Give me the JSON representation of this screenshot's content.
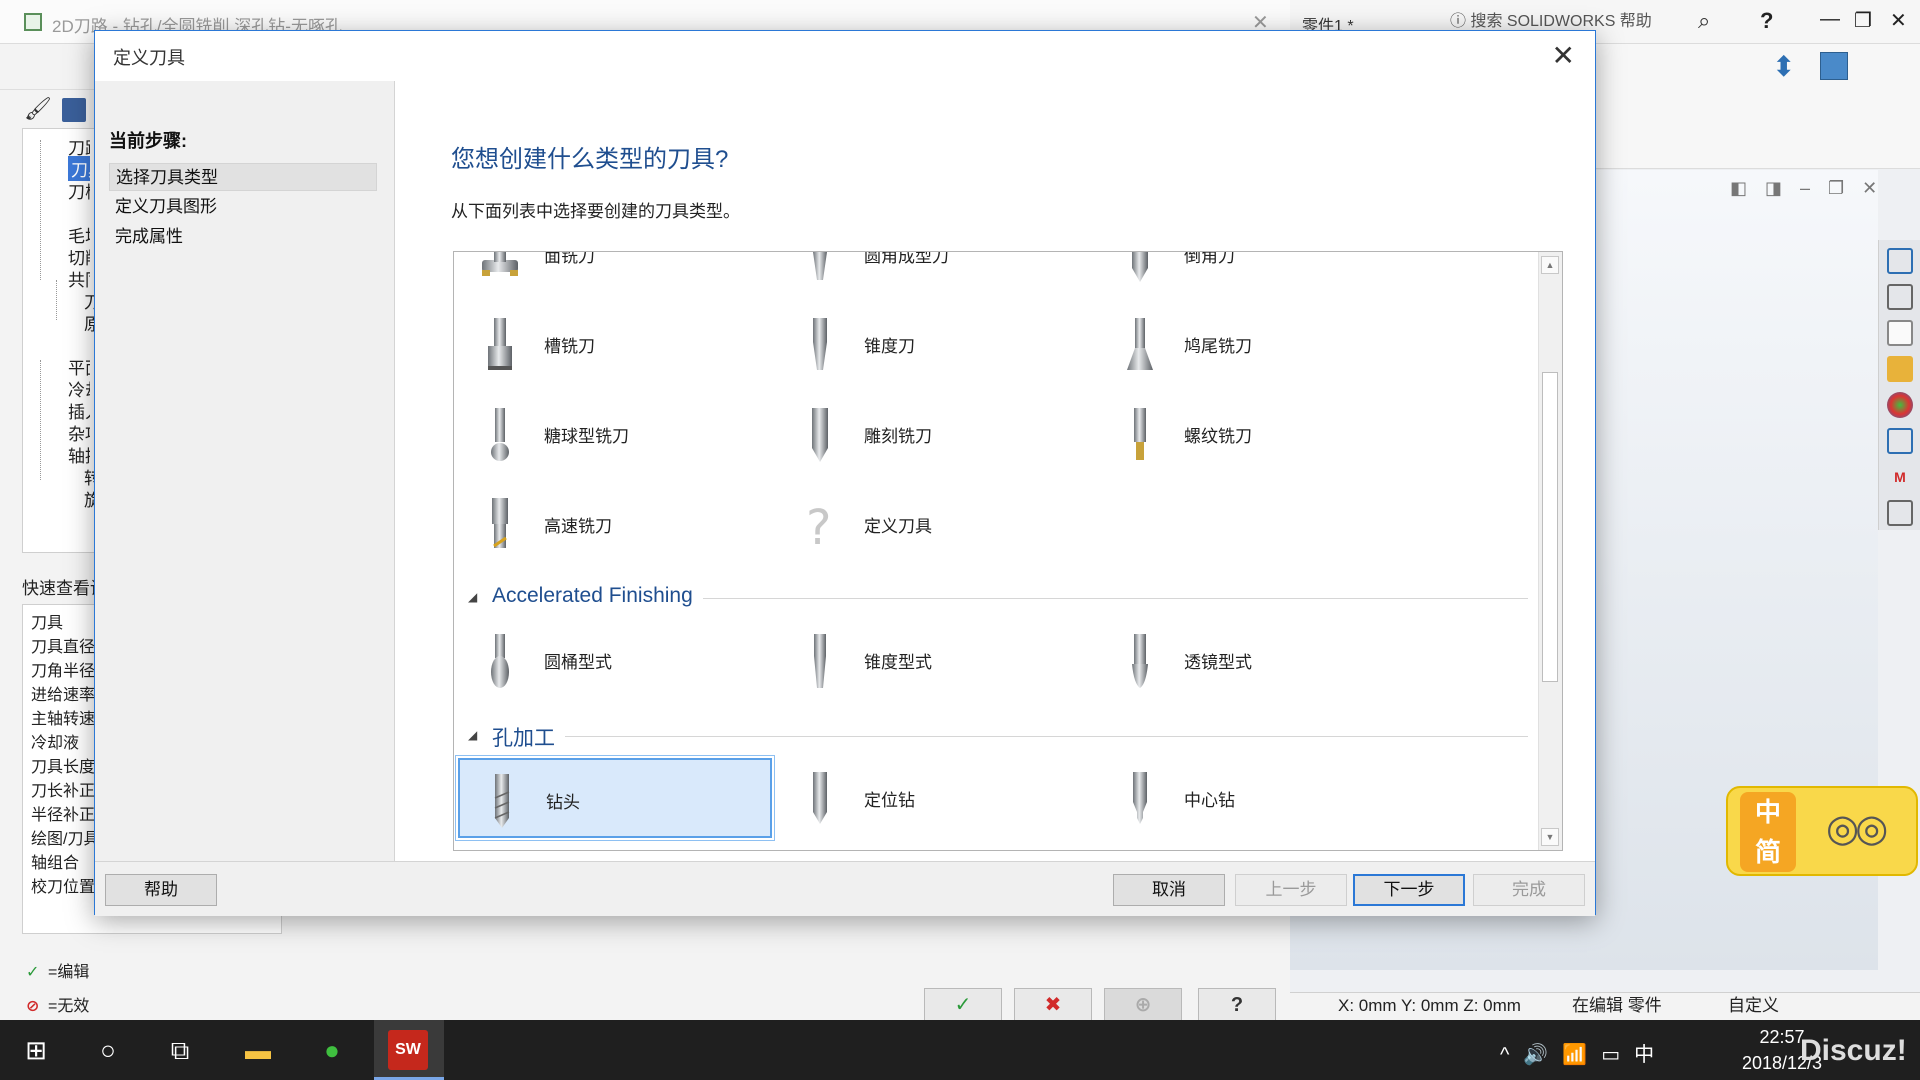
{
  "background": {
    "window_title": "2D刀路 - 钻孔/全圆铣削 深孔钻-无啄孔",
    "tree": [
      {
        "label": "刀路",
        "selected": false
      },
      {
        "label": "刀具",
        "selected": true
      },
      {
        "label": "刀柄",
        "selected": false
      },
      {
        "label": "毛坯",
        "selected": false
      },
      {
        "label": "切削",
        "selected": false
      },
      {
        "label": "共同",
        "selected": false
      },
      {
        "label": "刀",
        "selected": false
      },
      {
        "label": "原",
        "selected": false
      },
      {
        "label": "平面",
        "selected": false
      },
      {
        "label": "冷却",
        "selected": false
      },
      {
        "label": "插入",
        "selected": false
      },
      {
        "label": "杂项",
        "selected": false
      },
      {
        "label": "轴控",
        "selected": false
      },
      {
        "label": "转",
        "selected": false
      },
      {
        "label": "旋",
        "selected": false
      }
    ],
    "quick_view_label": "快速查看设",
    "quick_view_items": [
      "刀具",
      "刀具直径",
      "刀角半径",
      "进给速率",
      "主轴转速",
      "冷却液",
      "刀具长度",
      "刀长补正",
      "半径补正",
      "绘图/刀具",
      "轴组合",
      "校刀位置"
    ],
    "legend_edit": "=编辑",
    "legend_invalid": "=无效"
  },
  "solidworks": {
    "doc_title": "零件1 *",
    "search_placeholder": "搜索 SOLIDWORKS 帮助",
    "status_coords": "X: 0mm Y: 0mm Z: 0mm",
    "status_editing": "在编辑 零件",
    "status_custom": "自定义"
  },
  "dialog": {
    "title": "定义刀具",
    "steps_title": "当前步骤:",
    "steps": [
      "选择刀具类型",
      "定义刀具图形",
      "完成属性"
    ],
    "current_step": 0,
    "heading": "您想创建什么类型的刀具?",
    "subheading": "从下面列表中选择要创建的刀具类型。",
    "partial_row": [
      "面铣刀",
      "圆角成型刀",
      "倒角刀"
    ],
    "rows": [
      [
        "槽铣刀",
        "锥度刀",
        "鸠尾铣刀"
      ],
      [
        "糖球型铣刀",
        "雕刻铣刀",
        "螺纹铣刀"
      ],
      [
        "高速铣刀",
        "定义刀具"
      ]
    ],
    "groups": [
      {
        "title": "Accelerated Finishing",
        "tools": [
          "圆桶型式",
          "锥度型式",
          "透镜型式"
        ]
      },
      {
        "title": "孔加工",
        "tools": [
          "钻头",
          "定位钻",
          "中心钻"
        ],
        "selected_index": 0
      }
    ],
    "buttons": {
      "help": "帮助",
      "cancel": "取消",
      "prev": "上一步",
      "next": "下一步",
      "finish": "完成"
    }
  },
  "ime": {
    "top": "中",
    "bottom": "简"
  },
  "taskbar": {
    "clock_time": "22:57",
    "clock_date": "2018/12/3",
    "tray_lang": "中",
    "watermark": "Discuz!"
  },
  "colors": {
    "accent": "#2b78d6",
    "heading": "#1f4e8f",
    "selection": "#d9e9fb"
  }
}
